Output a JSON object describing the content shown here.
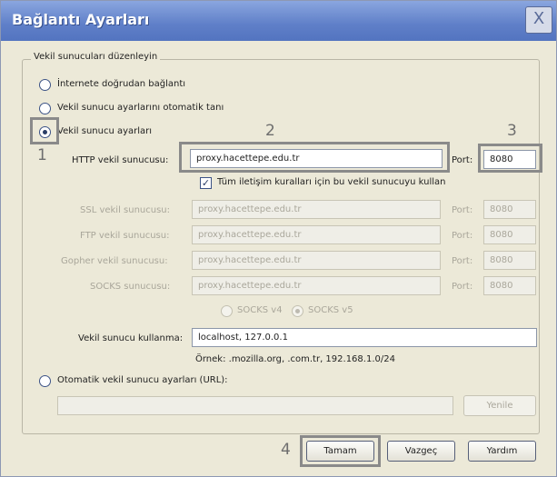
{
  "window": {
    "title": "Bağlantı Ayarları",
    "close_glyph": "X"
  },
  "group": {
    "legend": "Vekil sunucuları düzenleyin"
  },
  "options": {
    "direct": "İnternete doğrudan bağlantı",
    "auto_detect": "Vekil sunucu ayarlarını otomatik tanı",
    "manual": "Vekil sunucu ayarları",
    "selected": "manual"
  },
  "manual": {
    "http_label": "HTTP vekil sunucusu:",
    "http_value": "proxy.hacettepe.edu.tr",
    "port_label": "Port:",
    "http_port": "8080",
    "use_for_all_label": "Tüm iletişim kuralları için bu vekil sunucuyu kullan",
    "use_for_all_checked": true,
    "rows": [
      {
        "label": "SSL vekil sunucusu:",
        "value": "proxy.hacettepe.edu.tr",
        "port": "8080"
      },
      {
        "label": "FTP vekil sunucusu:",
        "value": "proxy.hacettepe.edu.tr",
        "port": "8080"
      },
      {
        "label": "Gopher vekil sunucusu:",
        "value": "proxy.hacettepe.edu.tr",
        "port": "8080"
      },
      {
        "label": "SOCKS sunucusu:",
        "value": "proxy.hacettepe.edu.tr",
        "port": "8080"
      }
    ],
    "socks_v4": "SOCKS v4",
    "socks_v5": "SOCKS v5",
    "socks_selected": "v5",
    "no_proxy_label": "Vekil sunucu kullanma:",
    "no_proxy_value": "localhost, 127.0.0.1",
    "example": "Örnek: .mozilla.org, .com.tr, 192.168.1.0/24"
  },
  "auto_url": {
    "label": "Otomatik vekil sunucu ayarları (URL):",
    "value": "",
    "reload_button": "Yenile"
  },
  "annotations": {
    "one": "1",
    "two": "2",
    "three": "3",
    "four": "4"
  },
  "buttons": {
    "ok": "Tamam",
    "cancel": "Vazgeç",
    "help": "Yardım"
  }
}
